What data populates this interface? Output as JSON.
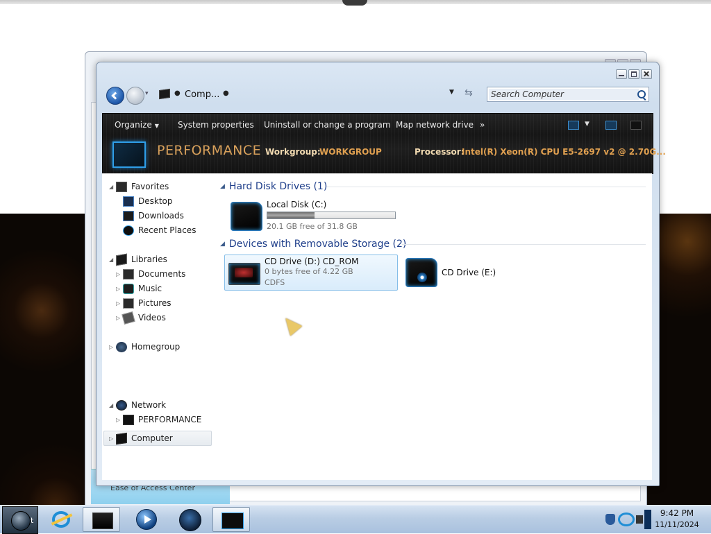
{
  "window": {
    "address": {
      "breadcrumb": "Comp..."
    },
    "search": {
      "placeholder": "Search Computer"
    },
    "toolbar": {
      "organize": "Organize",
      "system_properties": "System properties",
      "uninstall": "Uninstall or change a program",
      "map_drive": "Map network drive",
      "more": "»"
    },
    "banner": {
      "computer_name": "PERFORMANCE",
      "workgroup_label": "Workgroup:",
      "workgroup_value": "WORKGROUP",
      "processor_label": "Processor:",
      "processor_value": "Intel(R) Xeon(R) CPU E5-2697 v2 @ 2.70G..."
    }
  },
  "nav_pane": {
    "favorites": {
      "label": "Favorites",
      "items": [
        {
          "label": "Desktop",
          "icon": "desktop-icon"
        },
        {
          "label": "Downloads",
          "icon": "downloads-icon"
        },
        {
          "label": "Recent Places",
          "icon": "recent-places-icon"
        }
      ]
    },
    "libraries": {
      "label": "Libraries",
      "items": [
        {
          "label": "Documents",
          "icon": "documents-icon"
        },
        {
          "label": "Music",
          "icon": "music-icon"
        },
        {
          "label": "Pictures",
          "icon": "pictures-icon"
        },
        {
          "label": "Videos",
          "icon": "videos-icon"
        }
      ]
    },
    "homegroup": {
      "label": "Homegroup"
    },
    "computer": {
      "label": "Computer",
      "selected": true
    },
    "network": {
      "label": "Network",
      "items": [
        {
          "label": "PERFORMANCE",
          "icon": "computer-icon"
        }
      ]
    }
  },
  "main_pane": {
    "groups": [
      {
        "title": "Hard Disk Drives (1)",
        "drives": [
          {
            "name": "Local Disk (C:)",
            "free_text": "20.1 GB free of 31.8 GB",
            "used_fraction": 0.368
          }
        ]
      },
      {
        "title": "Devices with Removable Storage (2)",
        "drives": [
          {
            "name": "CD Drive (D:) CD_ROM",
            "free_text": "0 bytes free of 4.22 GB",
            "filesystem": "CDFS",
            "selected": true
          },
          {
            "name": "CD Drive (E:)"
          }
        ]
      }
    ]
  },
  "background_window": {
    "partial_text": "Ease of Access Center"
  },
  "taskbar": {
    "start_label": "t",
    "clock": {
      "time": "9:42 PM",
      "date": "11/11/2024"
    },
    "pinned": [
      {
        "name": "Internet Explorer",
        "icon": "internet-explorer-icon"
      },
      {
        "name": "Windows Explorer",
        "icon": "explorer-icon",
        "active": true
      },
      {
        "name": "Windows Media Player",
        "icon": "media-player-icon"
      },
      {
        "name": "Network",
        "icon": "globe-icon"
      },
      {
        "name": "Computer",
        "icon": "monitor-icon",
        "active": true
      }
    ]
  },
  "colors": {
    "banner_accent": "#d9a15b",
    "banner_value": "#e0a050",
    "group_header": "#1e3e8a",
    "selection_border": "#84bde8"
  }
}
